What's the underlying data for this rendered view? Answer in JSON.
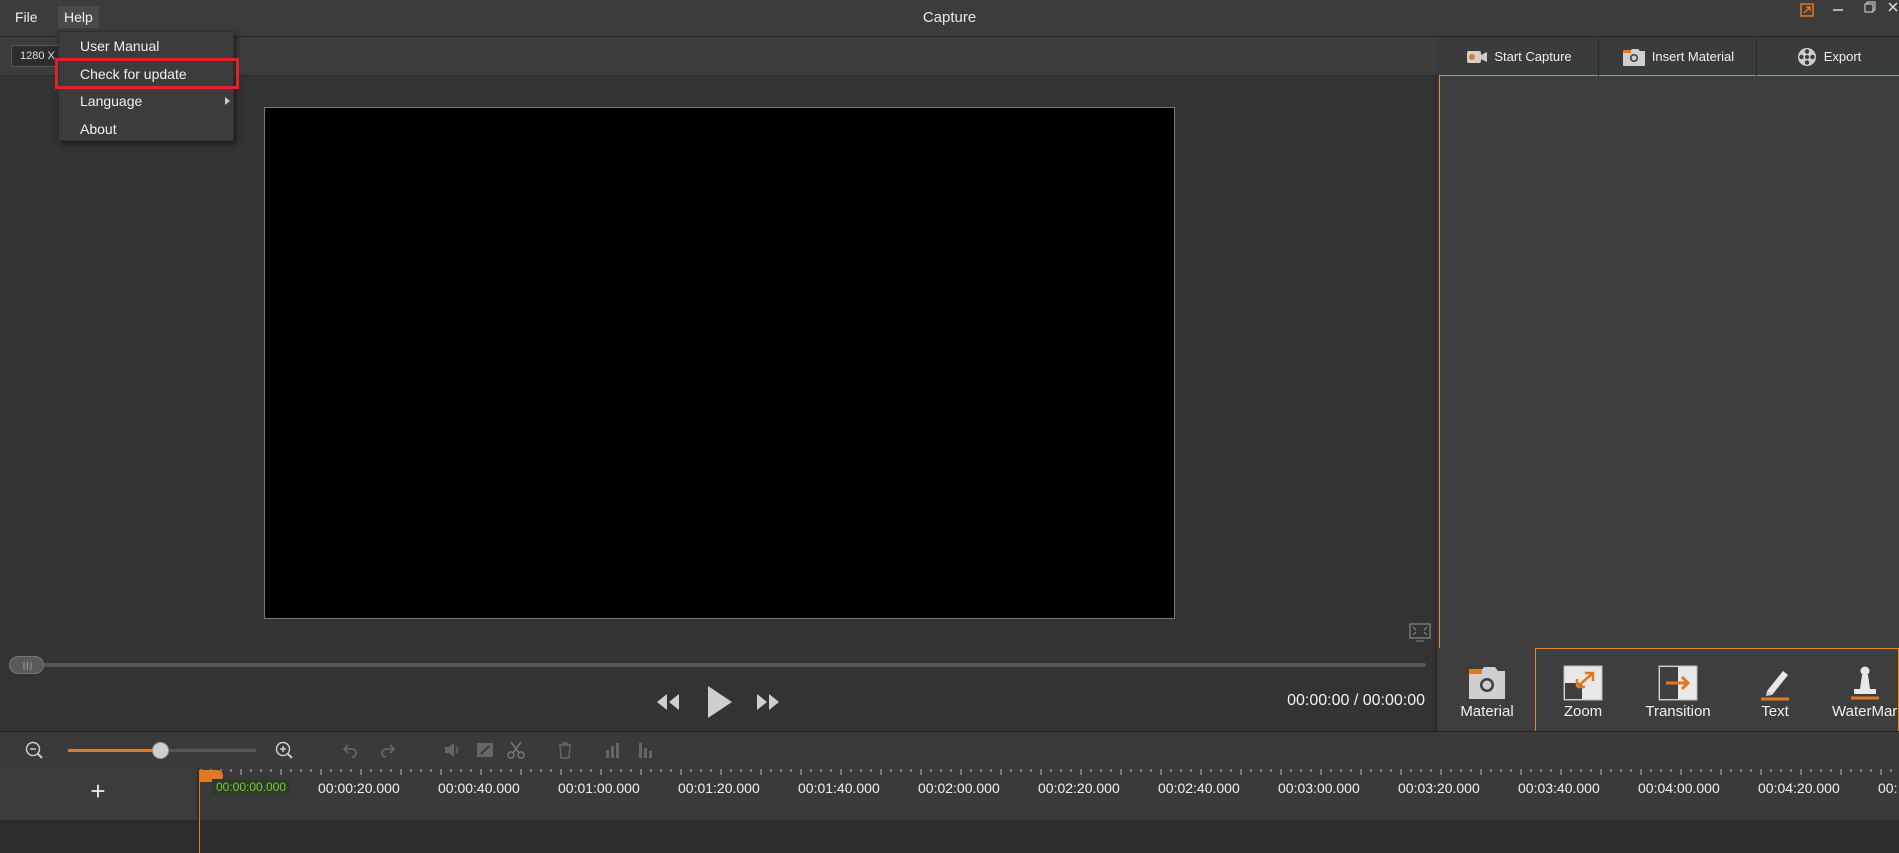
{
  "titlebar": {
    "app_title": "Capture",
    "menu": {
      "file": "File",
      "help": "Help"
    },
    "window_controls": {
      "restore": "⧉",
      "minimize": "—",
      "maximize": "▭",
      "close": "✕"
    }
  },
  "help_menu": {
    "items": [
      {
        "label": "User Manual"
      },
      {
        "label": "Check for update",
        "highlighted": true
      },
      {
        "label": "Language",
        "has_submenu": true
      },
      {
        "label": "About"
      }
    ]
  },
  "preview": {
    "resolution_label": "1280 X",
    "time_display": "00:00:00 / 00:00:00"
  },
  "right_toolbar": {
    "start_capture": "Start Capture",
    "insert_material": "Insert Material",
    "export": "Export"
  },
  "tool_tabs": [
    {
      "label": "Material",
      "icon": "camera-folder-icon",
      "active": true
    },
    {
      "label": "Zoom",
      "icon": "zoom-arrows-icon"
    },
    {
      "label": "Transition",
      "icon": "transition-arrow-icon"
    },
    {
      "label": "Text",
      "icon": "pencil-icon"
    },
    {
      "label": "WaterMar",
      "icon": "stamp-icon"
    }
  ],
  "timeline": {
    "zoom_level": 0.49,
    "playhead_time": "00:00:00.000",
    "ruler_labels": [
      "00:00:20.000",
      "00:00:40.000",
      "00:01:00.000",
      "00:01:20.000",
      "00:01:40.000",
      "00:02:00.000",
      "00:02:20.000",
      "00:02:40.000",
      "00:03:00.000",
      "00:03:20.000",
      "00:03:40.000",
      "00:04:00.000",
      "00:04:20.000",
      "00:"
    ],
    "add_track": "+"
  },
  "colors": {
    "accent": "#e07a20",
    "highlight_box": "#e0222a",
    "playhead_text": "#6fd12e"
  }
}
